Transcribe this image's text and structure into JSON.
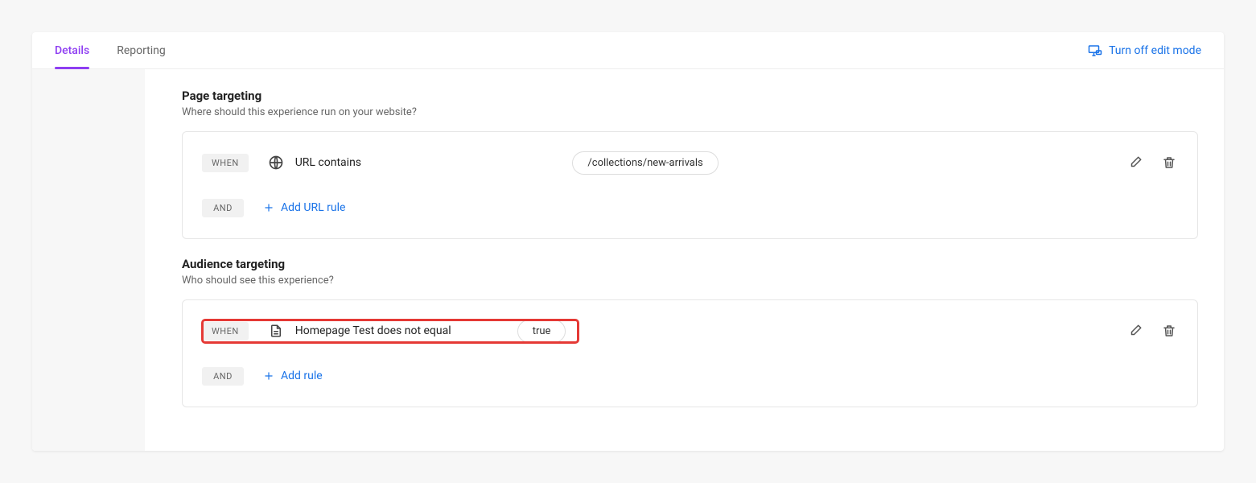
{
  "tabs": {
    "details": "Details",
    "reporting": "Reporting"
  },
  "toolbar": {
    "toggle_edit": "Turn off edit mode"
  },
  "page_targeting": {
    "title": "Page targeting",
    "subtitle": "Where should this experience run on your website?",
    "rule": {
      "badge": "WHEN",
      "label": "URL contains",
      "value": "/collections/new-arrivals"
    },
    "and_badge": "AND",
    "add_label": "Add URL rule"
  },
  "audience_targeting": {
    "title": "Audience targeting",
    "subtitle": "Who should see this experience?",
    "rule": {
      "badge": "WHEN",
      "label": "Homepage Test does not equal",
      "value": "true"
    },
    "and_badge": "AND",
    "add_label": "Add rule"
  }
}
